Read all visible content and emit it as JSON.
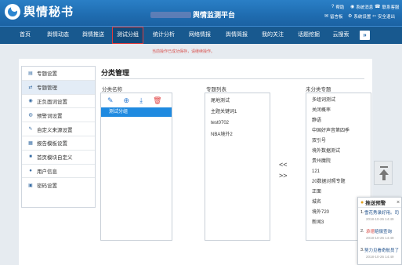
{
  "header": {
    "logo_text": "舆情秘书",
    "platform_title": "舆情监测平台",
    "util_links": [
      {
        "icon": "help-icon",
        "glyph": "?",
        "label": "帮助"
      },
      {
        "icon": "bulletin-icon",
        "glyph": "◉",
        "label": "系统消息"
      },
      {
        "icon": "contact-icon",
        "glyph": "☎",
        "label": "联系客服"
      },
      {
        "icon": "message-icon",
        "glyph": "✉",
        "label": "留言板"
      },
      {
        "icon": "settings-icon",
        "glyph": "⚙",
        "label": "系统设置"
      },
      {
        "icon": "logout-icon",
        "glyph": "⇦",
        "label": "安全退出"
      }
    ]
  },
  "nav": {
    "items": [
      "首页",
      "舆情动态",
      "舆情推送",
      "测试分组",
      "统计分析",
      "网络情报",
      "舆情简报",
      "我的关注",
      "话题挖掘",
      "云搜索"
    ],
    "more_glyph": "»"
  },
  "notice": {
    "text": "当前操作已成功保存，请继续操作。"
  },
  "sidebar": {
    "items": [
      {
        "icon": "topic-settings-icon",
        "glyph": "▤",
        "label": "专题设置"
      },
      {
        "icon": "topic-manage-icon",
        "glyph": "⇄",
        "label": "专题管理"
      },
      {
        "icon": "sentiment-settings-icon",
        "glyph": "◉",
        "label": "正负面词设置"
      },
      {
        "icon": "alert-words-icon",
        "glyph": "◍",
        "label": "预警词设置"
      },
      {
        "icon": "custom-source-icon",
        "glyph": "✎",
        "label": "自定义来源设置"
      },
      {
        "icon": "report-template-icon",
        "glyph": "▦",
        "label": "报告模板设置"
      },
      {
        "icon": "homepage-module-icon",
        "glyph": "■",
        "label": "首页模块自定义"
      },
      {
        "icon": "user-info-icon",
        "glyph": "●",
        "label": "用户信息"
      },
      {
        "icon": "password-icon",
        "glyph": "▣",
        "label": "密码设置"
      }
    ],
    "active_index": 1
  },
  "main": {
    "section_title": "分类管理",
    "category_header": "分类名称",
    "topic_list_header": "专题列表",
    "unclassified_header": "未分类专题",
    "toolbar": [
      {
        "icon": "edit-icon",
        "glyph": "✎"
      },
      {
        "icon": "add-icon",
        "glyph": "⊕"
      },
      {
        "icon": "download-icon",
        "glyph": "⤓"
      },
      {
        "icon": "delete-icon",
        "glyph": "🗑"
      }
    ],
    "categories": [
      "测试分组"
    ],
    "topic_list": [
      "尾地测试",
      "主题关键词1",
      "test0702",
      "NBA境外2"
    ],
    "unclassified": [
      "多组词测试",
      "关闭概率",
      "静语",
      "中国好声音第四季",
      "双引号",
      "境外数据测试",
      "贵州魔院",
      "121",
      "20数据对照专题",
      "正面",
      "城名",
      "境外720",
      "新闻3"
    ],
    "move_left": "<<",
    "move_right": ">>"
  },
  "alert": {
    "title": "推送预警",
    "close": "×",
    "items": [
      {
        "num": "1.",
        "prefix": "",
        "text": "雪花秀录好用。司",
        "time": "2018-10-26 14:49"
      },
      {
        "num": "2.",
        "prefix": "承德",
        "text": "赔偿查询",
        "time": "2018-10-26 14:49"
      },
      {
        "num": "3.",
        "prefix": "",
        "text": "努力见看奇航员了",
        "time": "2018-10-26 14:49"
      }
    ]
  },
  "colors": {
    "header_blue": "#1f6cb0",
    "nav_blue": "#18598f",
    "active_outline": "#e23b3b",
    "selected_row": "#1f8ae0",
    "notice_red": "#d9534f"
  }
}
